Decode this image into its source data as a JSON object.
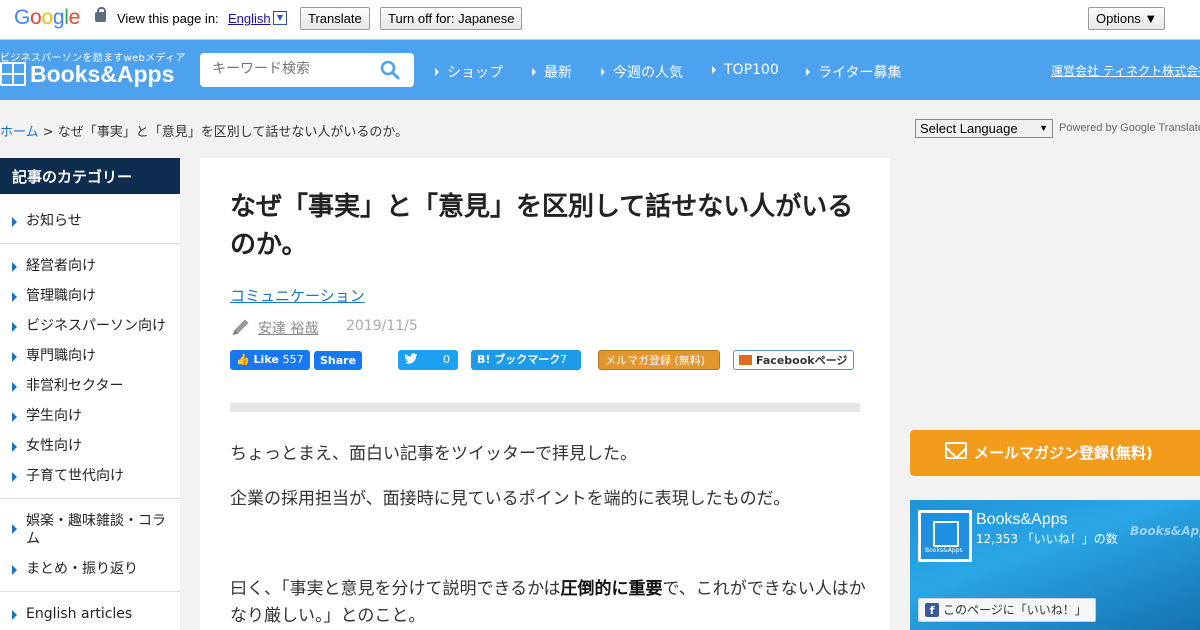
{
  "translate_bar": {
    "logo": "Google",
    "view_text": "View this page in:",
    "language": "English",
    "translate_label": "Translate",
    "turn_off_label": "Turn off for: Japanese",
    "options_label": "Options ▼"
  },
  "header": {
    "tagline": "ビジネスパーソンを励ますwebメディア",
    "logo_text": "Books&Apps",
    "search_placeholder": "キーワード検索",
    "nav": [
      "ショップ",
      "最新",
      "今週の人気",
      "TOP100",
      "ライター募集"
    ],
    "corp_link": "運営会社 ティネクト株式会社"
  },
  "breadcrumb": {
    "home": "ホーム",
    "current": " > なぜ「事実」と「意見」を区別して話せない人がいるのか。"
  },
  "translate_widget": {
    "select_label": "Select Language",
    "powered_text": "Powered by Google Translate"
  },
  "sidebar": {
    "heading": "記事のカテゴリー",
    "items": [
      "お知らせ",
      "経営者向け",
      "管理職向け",
      "ビジネスパーソン向け",
      "専門職向け",
      "非営利セクター",
      "学生向け",
      "女性向け",
      "子育て世代向け",
      "娯楽・趣味雑談・コラム",
      "まとめ・振り返り",
      "English articles"
    ]
  },
  "article": {
    "title": "なぜ「事実」と「意見」を区別して話せない人がいるのか。",
    "category": "コミュニケーション",
    "author": "安達 裕哉",
    "date": "2019/11/5",
    "share": {
      "fb_like": "Like",
      "fb_like_count": "557",
      "fb_share": "Share",
      "tweet_count": "0",
      "hatena": "B! ブックマーク",
      "hatena_count": "7",
      "mailmag": "メルマガ登録 (無料)",
      "fb_page": "Facebookページ"
    },
    "para1": "ちょっとまえ、面白い記事をツイッターで拝見した。",
    "para2": "企業の採用担当が、面接時に見ているポイントを端的に表現したものだ。",
    "para3_before": "曰く、「事実と意見を分けて説明できるかは",
    "para3_bold": "圧倒的に重要",
    "para3_after": "で、これができない人はかなり厳しい。」とのこと。"
  },
  "right": {
    "mail_button": "メールマガジン登録(無料)",
    "fb_name": "Books&Apps",
    "fb_count": "12,353 「いいね！」の数",
    "fb_watermark": "Books&Apps",
    "fb_like_page": "このページに「いいね！」"
  },
  "colors": {
    "header_blue": "#4da2f0",
    "sidebar_heading": "#0e2c4d",
    "mail_orange": "#f39c1c",
    "link_blue": "#1a73c8"
  }
}
